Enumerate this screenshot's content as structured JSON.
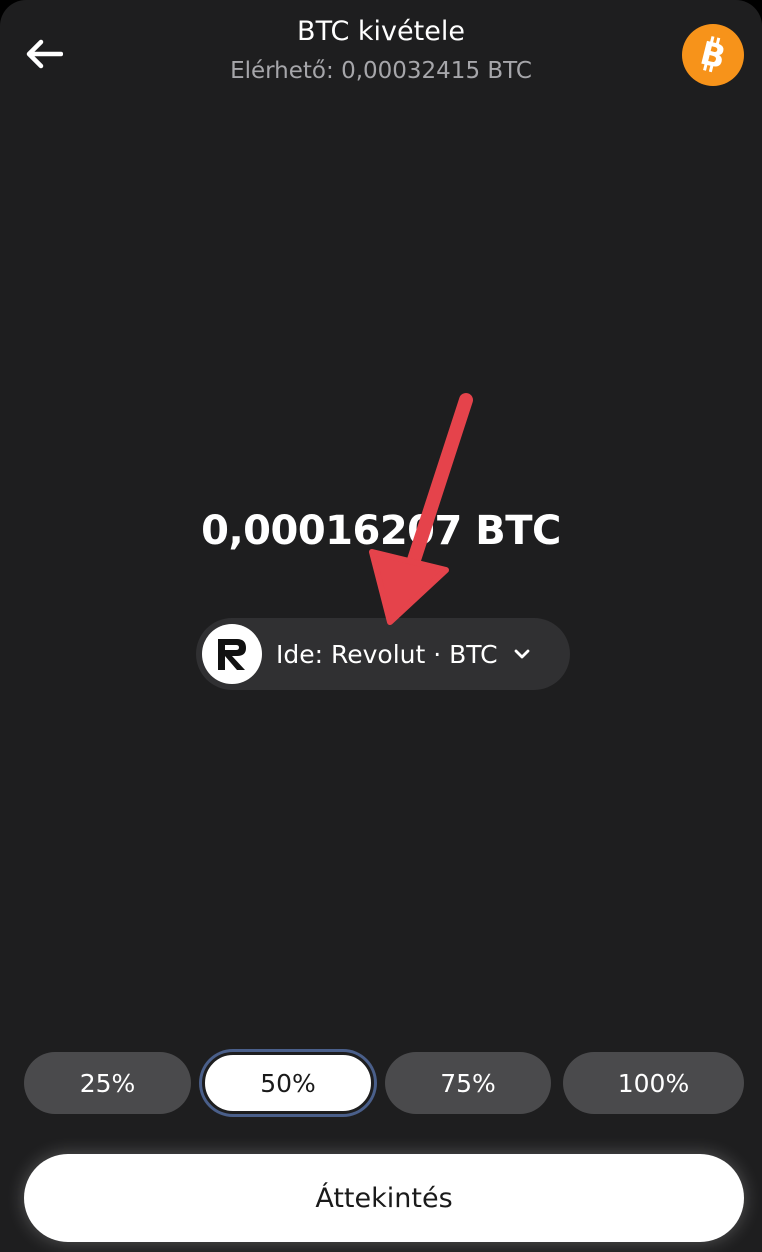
{
  "header": {
    "title": "BTC kivétele",
    "available": "Elérhető: 0,00032415 BTC"
  },
  "icons": {
    "back": "arrow-left-icon",
    "coin": "bitcoin-icon",
    "destination_logo": "revolut-logo-icon",
    "chevron": "chevron-down-icon",
    "annotation": "red-arrow-annotation"
  },
  "amount": {
    "value": "0,00016207 BTC"
  },
  "destination": {
    "label": "Ide: Revolut · BTC"
  },
  "percent_options": [
    {
      "label": "25%",
      "selected": false
    },
    {
      "label": "50%",
      "selected": true
    },
    {
      "label": "75%",
      "selected": false
    },
    {
      "label": "100%",
      "selected": false
    }
  ],
  "review_button": {
    "label": "Áttekintés"
  },
  "colors": {
    "background": "#1e1e1f",
    "bitcoin_orange": "#f7931a",
    "annotation_red": "#e5434b",
    "pill_background": "#303032",
    "percent_button": "#4a4a4c",
    "selected_ring": "#4a5f8a"
  }
}
